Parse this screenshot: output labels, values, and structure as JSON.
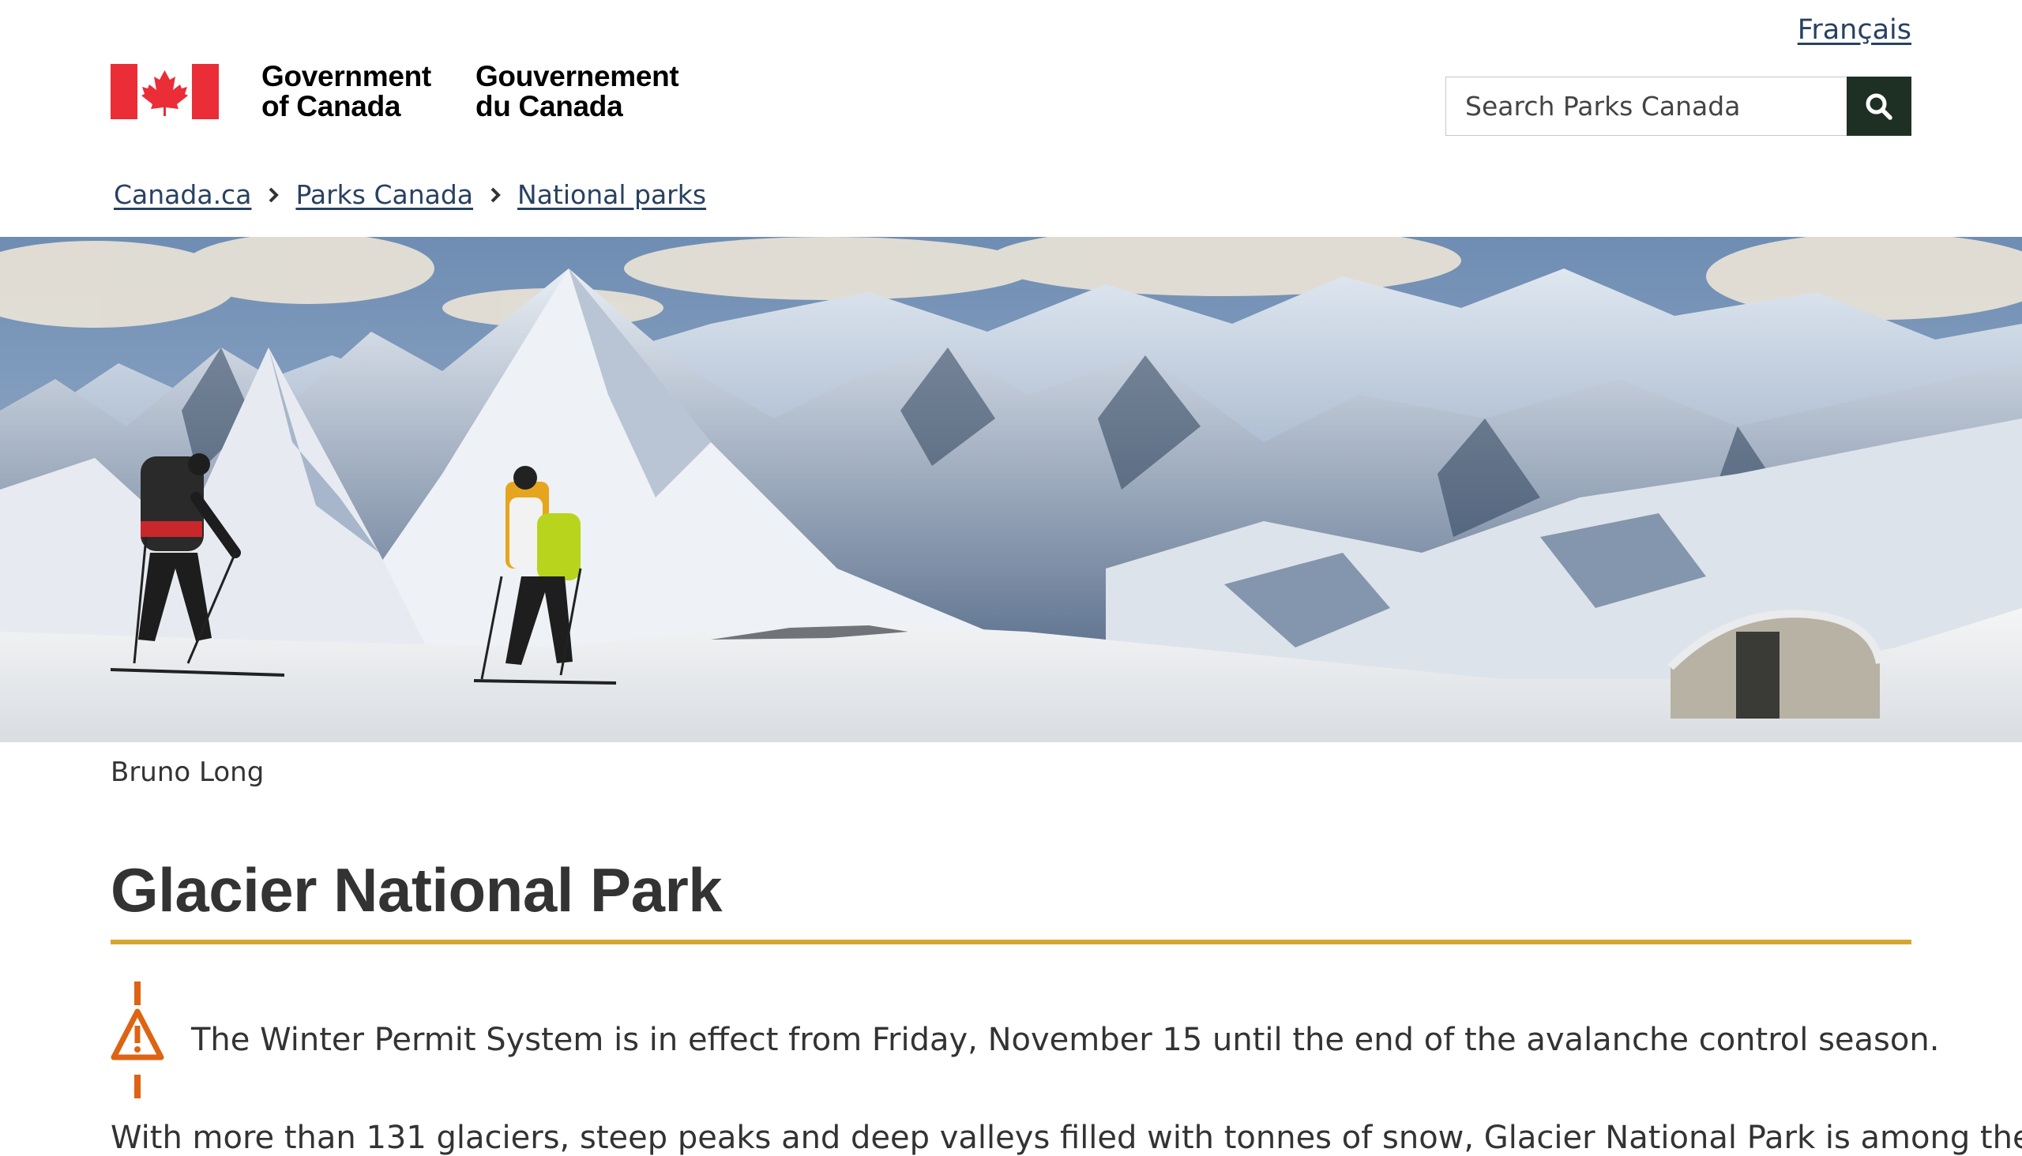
{
  "header": {
    "language_link": "Français",
    "wordmark": {
      "en_line1": "Government",
      "en_line2": "of Canada",
      "fr_line1": "Gouvernement",
      "fr_line2": "du Canada"
    },
    "search": {
      "placeholder": "Search Parks Canada",
      "button_icon": "search-icon"
    }
  },
  "breadcrumb": [
    {
      "label": "Canada.ca"
    },
    {
      "label": "Parks Canada"
    },
    {
      "label": "National parks"
    }
  ],
  "hero": {
    "photo_credit": "Bruno Long"
  },
  "main": {
    "title": "Glacier National Park",
    "alert": {
      "icon": "warning-icon",
      "text": "The Winter Permit System is in effect from Friday, November 15 until the end of the avalanche control season."
    },
    "intro_partial": "With more than 131 glaciers, steep peaks and deep valleys filled with tonnes of snow, Glacier National Park is among the"
  },
  "colors": {
    "link": "#284162",
    "flag_red": "#eb2d37",
    "search_button": "#1e2f24",
    "title_rule": "#d4a631",
    "alert_orange": "#dc6413"
  }
}
